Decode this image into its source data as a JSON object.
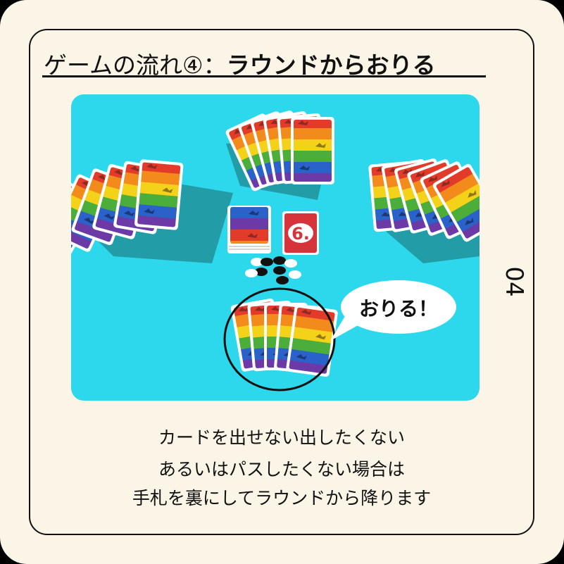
{
  "title": {
    "prefix": "ゲームの流れ④：",
    "main": "ラウンドからおりる"
  },
  "speech_bubble": "おりる！",
  "page_number": "04",
  "card_face_value": "6.",
  "caption_lines": [
    "カードを出せない出したくない",
    "あるいはパスしたくない場合は",
    "手札を裏にしてラウンドから降ります"
  ],
  "colors": {
    "background": "#faf5e6",
    "scene": "#2ed8ec",
    "card_face_red": "#d6333a",
    "rainbow": [
      "#e23b2a",
      "#f28a1c",
      "#f5d21a",
      "#4cae3a",
      "#2a62c9",
      "#6b3aa6"
    ]
  }
}
